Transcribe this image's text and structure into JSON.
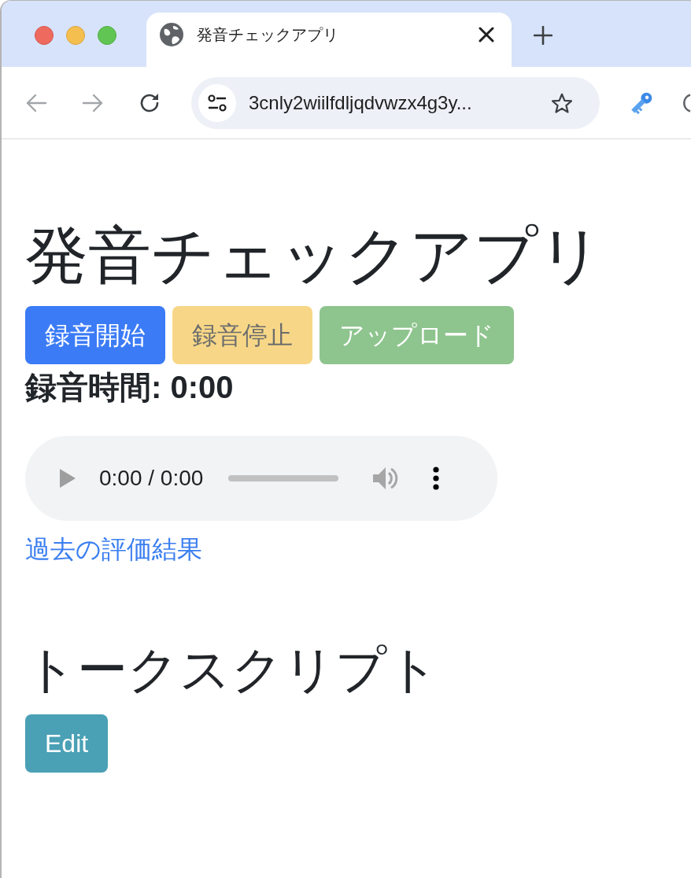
{
  "browser": {
    "tab": {
      "title": "発音チェックアプリ",
      "selected": true
    },
    "address_bar": {
      "url": "3cnly2wiilfdljqdvwzx4g3y..."
    }
  },
  "page": {
    "title": "発音チェックアプリ",
    "buttons": [
      {
        "label": "録音開始",
        "kind": "primary",
        "disabled": false
      },
      {
        "label": "録音停止",
        "kind": "warning",
        "disabled": true
      },
      {
        "label": "アップロード",
        "kind": "success",
        "disabled": true
      }
    ],
    "recording_time": "録音時間: 0:00",
    "audio_player": {
      "time": "0:00 / 0:00"
    },
    "link": "過去の評価結果",
    "section": {
      "title": "トークスクリプト",
      "button": "Edit"
    }
  }
}
